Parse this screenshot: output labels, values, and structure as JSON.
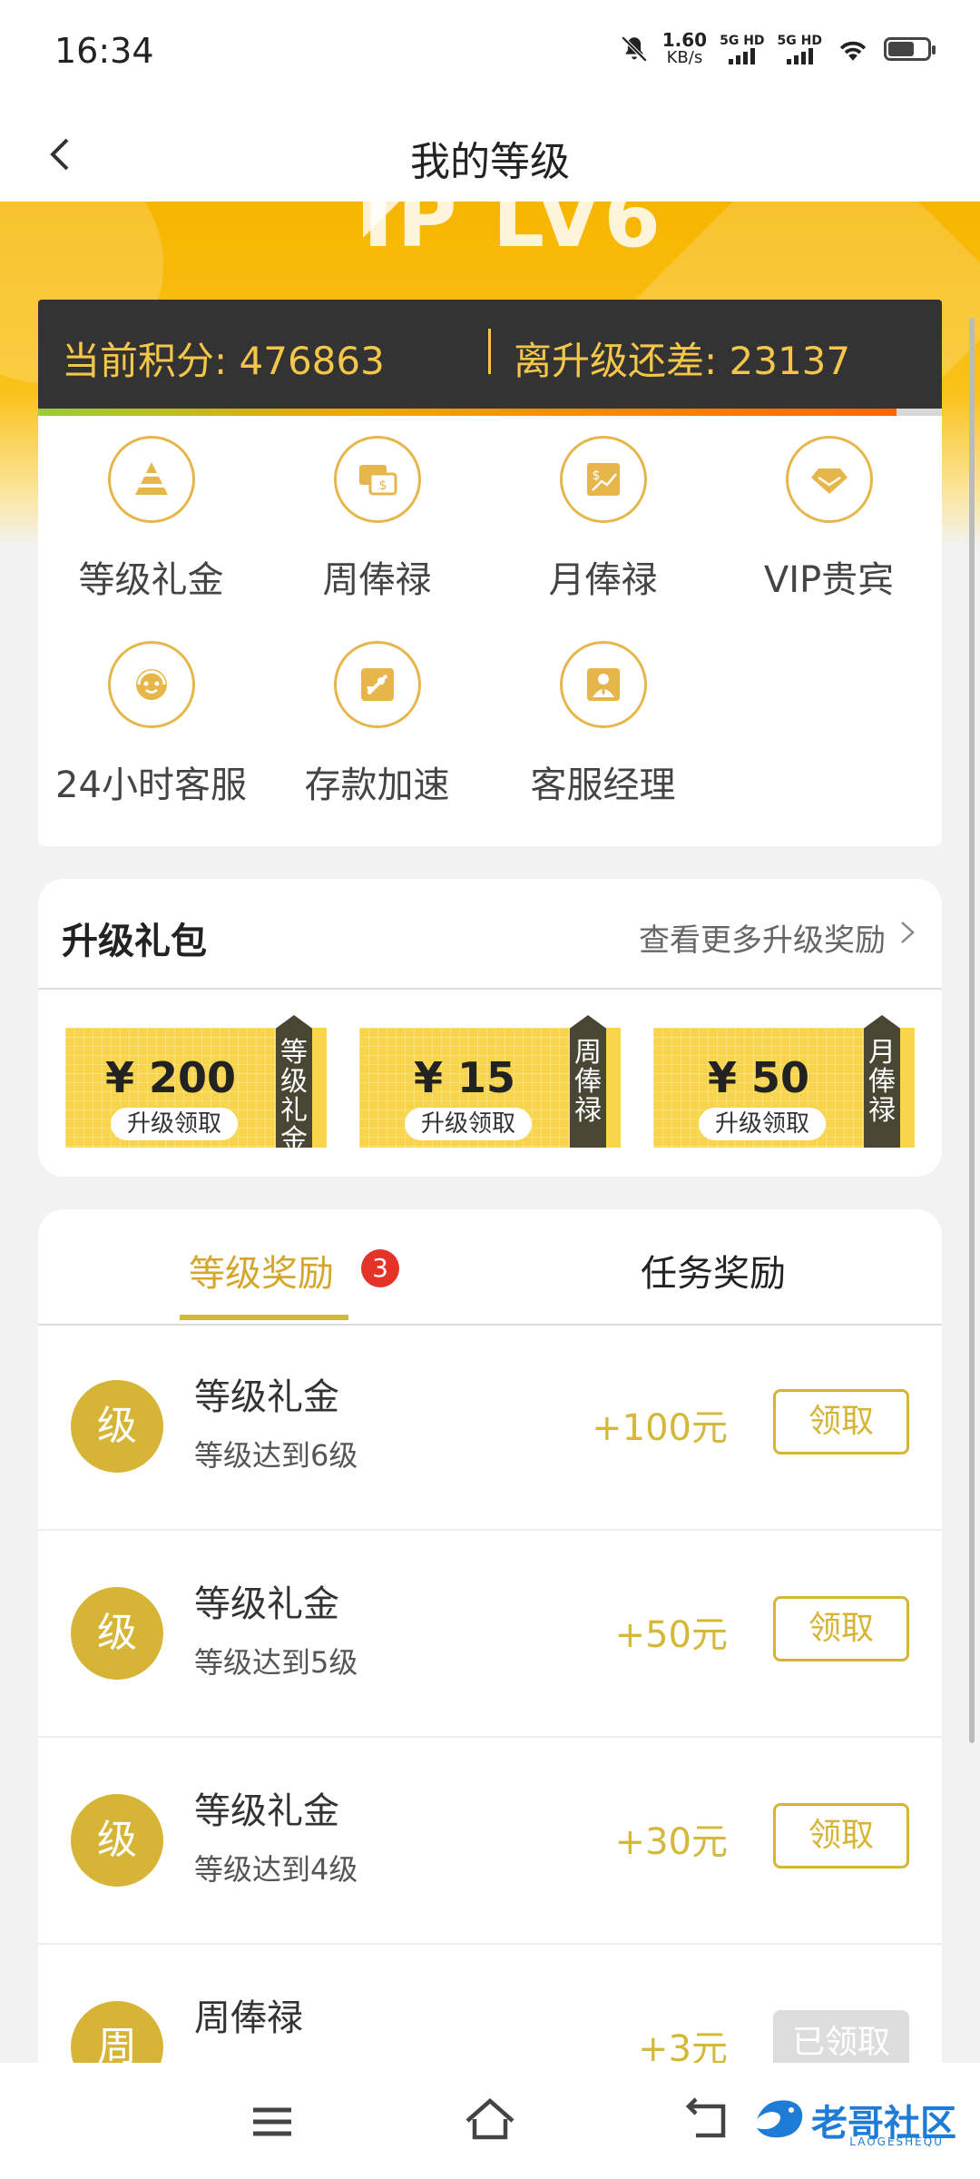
{
  "status": {
    "time": "16:34",
    "speed_value": "1.60",
    "speed_unit": "KB/s",
    "net1": "5G HD",
    "net2": "5G HD"
  },
  "header": {
    "title": "我的等级"
  },
  "banner": {
    "vip_text": "IP LV6"
  },
  "points": {
    "current": "当前积分: 476863",
    "remaining": "离升级还差: 23137",
    "progress_percent": 95
  },
  "privileges": [
    {
      "label": "等级礼金",
      "icon": "pyramid-icon"
    },
    {
      "label": "周俸禄",
      "icon": "weekly-salary-icon"
    },
    {
      "label": "月俸禄",
      "icon": "monthly-salary-icon"
    },
    {
      "label": "VIP贵宾",
      "icon": "diamond-icon"
    },
    {
      "label": "24小时客服",
      "icon": "headset-icon"
    },
    {
      "label": "存款加速",
      "icon": "rocket-icon"
    },
    {
      "label": "客服经理",
      "icon": "manager-icon"
    }
  ],
  "gift": {
    "title": "升级礼包",
    "more": "查看更多升级奖励",
    "coupons": [
      {
        "amount": "¥ 200",
        "sub": "升级领取",
        "tag": "等级礼金"
      },
      {
        "amount": "¥ 15",
        "sub": "升级领取",
        "tag": "周俸禄"
      },
      {
        "amount": "¥ 50",
        "sub": "升级领取",
        "tag": "月俸禄"
      }
    ]
  },
  "rewards": {
    "tab_level": "等级奖励",
    "tab_badge": "3",
    "tab_task": "任务奖励",
    "items": [
      {
        "avatar": "级",
        "title": "等级礼金",
        "desc": "等级达到6级",
        "amount": "+100元",
        "button": "领取"
      },
      {
        "avatar": "级",
        "title": "等级礼金",
        "desc": "等级达到5级",
        "amount": "+50元",
        "button": "领取"
      },
      {
        "avatar": "级",
        "title": "等级礼金",
        "desc": "等级达到4级",
        "amount": "+30元",
        "button": "领取"
      },
      {
        "avatar": "周",
        "title": "周俸禄",
        "desc": "",
        "amount": "+3元",
        "button": "已领取"
      }
    ]
  },
  "watermark": {
    "text": "老哥社区",
    "sub": "LAOGESHEQU"
  },
  "colors": {
    "gold": "#d6b536",
    "dark": "#333333",
    "banner": "#f7b500",
    "badge": "#e5332a"
  }
}
